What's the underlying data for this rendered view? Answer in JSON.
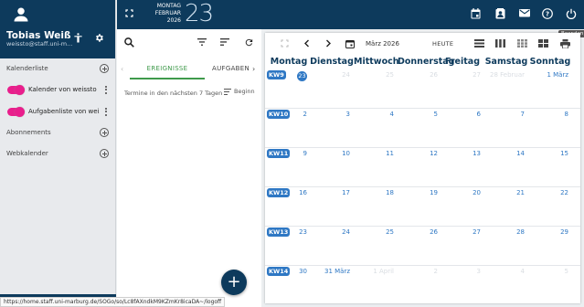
{
  "user": {
    "name": "Tobias Weiß",
    "email": "weissto@staff.uni-m..."
  },
  "sidebar": {
    "calendar_section": "Kalenderliste",
    "calendars": [
      {
        "label": "Kalender von weissto",
        "color": "#e91e8c"
      },
      {
        "label": "Aufgabenliste von weis...",
        "color": "#e91e8c"
      }
    ],
    "subscriptions_section": "Abonnements",
    "webcal_section": "Webkalender"
  },
  "date_header": {
    "weekday": "MONTAG",
    "month": "FEBRUAR",
    "year": "2026",
    "day": "23"
  },
  "topbar": {
    "tooltip": "Beenden"
  },
  "events_panel": {
    "tab_events": "EREIGNISSE",
    "tab_tasks": "AUFGABEN",
    "filter_label": "Termine in den nächsten 7 Tagen",
    "sort_label": "Beginn"
  },
  "calendar": {
    "month_label": "März 2026",
    "today_button": "HEUTE",
    "weekdays": [
      "Montag",
      "Dienstag",
      "Mittwoch",
      "Donnerstag",
      "Freitag",
      "Samstag",
      "Sonntag"
    ],
    "weeks": [
      {
        "kw": "KW9",
        "days": [
          "23",
          "24",
          "25",
          "26",
          "27",
          "28 Februar",
          "1 März"
        ],
        "faded": [
          false,
          true,
          true,
          true,
          true,
          true,
          false
        ],
        "today_index": 0
      },
      {
        "kw": "KW10",
        "days": [
          "2",
          "3",
          "4",
          "5",
          "6",
          "7",
          "8"
        ]
      },
      {
        "kw": "KW11",
        "days": [
          "9",
          "10",
          "11",
          "12",
          "13",
          "14",
          "15"
        ]
      },
      {
        "kw": "KW12",
        "days": [
          "16",
          "17",
          "18",
          "19",
          "20",
          "21",
          "22"
        ]
      },
      {
        "kw": "KW13",
        "days": [
          "23",
          "24",
          "25",
          "26",
          "27",
          "28",
          "29"
        ]
      },
      {
        "kw": "KW14",
        "days": [
          "30",
          "31 März",
          "1 April",
          "2",
          "3",
          "4",
          "5"
        ],
        "faded": [
          false,
          false,
          true,
          true,
          true,
          true,
          true
        ]
      }
    ]
  },
  "statusbar": {
    "url": "https://home.staff.uni-marburg.de/SOGo/so/Lc8fAXndkM9KZmKr8icaDA~/logoff"
  },
  "colors": {
    "primary": "#0d3a5c",
    "accent": "#2f78c4",
    "green": "#3f9a4b",
    "pink": "#e91e8c"
  }
}
